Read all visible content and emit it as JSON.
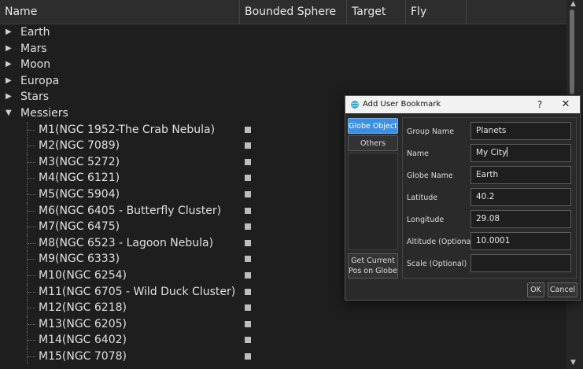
{
  "tree": {
    "columns": [
      "Name",
      "Bounded Sphere",
      "Target",
      "Fly"
    ],
    "groups": [
      {
        "label": "Earth",
        "expanded": false
      },
      {
        "label": "Mars",
        "expanded": false
      },
      {
        "label": "Moon",
        "expanded": false
      },
      {
        "label": "Europa",
        "expanded": false
      },
      {
        "label": "Stars",
        "expanded": false
      },
      {
        "label": "Messiers",
        "expanded": true
      }
    ],
    "messier_items": [
      "M1(NGC 1952-The Crab Nebula)",
      "M2(NGC 7089)",
      "M3(NGC 5272)",
      "M4(NGC 6121)",
      "M5(NGC 5904)",
      "M6(NGC 6405 - Butterfly Cluster)",
      "M7(NGC 6475)",
      "M8(NGC 6523 - Lagoon Nebula)",
      "M9(NGC 6333)",
      "M10(NGC 6254)",
      "M11(NGC 6705 - Wild Duck Cluster)",
      "M12(NGC 6218)",
      "M13(NGC 6205)",
      "M14(NGC 6402)",
      "M15(NGC 7078)"
    ],
    "icons": {
      "collapsed": "triangle-right",
      "expanded": "triangle-down",
      "checkbox": "square-checkbox"
    }
  },
  "dialog": {
    "title": "Add User Bookmark",
    "help": "?",
    "close": "✕",
    "tabs": [
      "Globe Object",
      "Others"
    ],
    "get_pos_label_1": "Get Current",
    "get_pos_label_2": "Pos on Globe",
    "fields": [
      {
        "label": "Group Name",
        "value": "Planets"
      },
      {
        "label": "Name",
        "value": "My City"
      },
      {
        "label": "Globe Name",
        "value": "Earth"
      },
      {
        "label": "Latitude",
        "value": "40.2"
      },
      {
        "label": "Longitude",
        "value": "29.08"
      },
      {
        "label": "Altitude (Optional)",
        "value": "10.0001"
      },
      {
        "label": "Scale (Optional)",
        "value": ""
      }
    ],
    "ok_label": "OK",
    "cancel_label": "Cancel",
    "colors": {
      "accent": "#3d8fe0",
      "background": "#2a2a2a",
      "titlebar": "#f2f2f2"
    }
  }
}
